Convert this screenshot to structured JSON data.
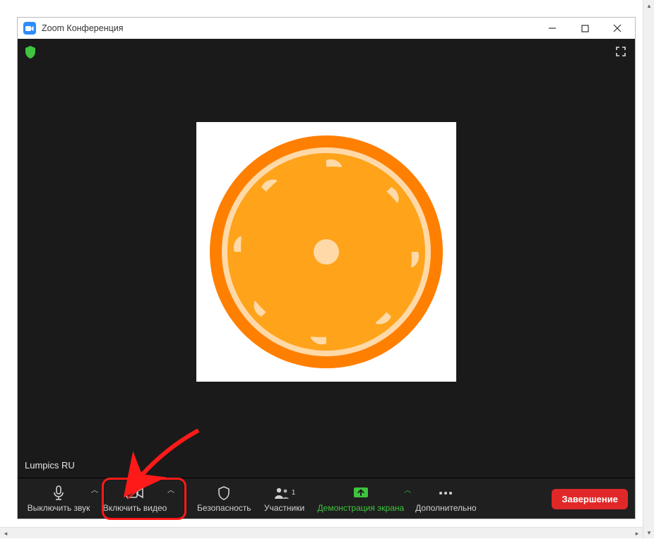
{
  "window": {
    "title": "Zoom Конференция"
  },
  "meeting": {
    "participant_name": "Lumpics RU"
  },
  "toolbar": {
    "mute": {
      "label": "Выключить звук"
    },
    "video": {
      "label": "Включить видео"
    },
    "security": {
      "label": "Безопасность"
    },
    "participants": {
      "label": "Участники",
      "count": "1"
    },
    "share": {
      "label": "Демонстрация экрана"
    },
    "more": {
      "label": "Дополнительно"
    },
    "end": {
      "label": "Завершение"
    }
  },
  "colors": {
    "accent": "#2d8cff",
    "share_green": "#3ec43e",
    "end_red": "#e02828",
    "highlight": "#ff1a1a"
  }
}
